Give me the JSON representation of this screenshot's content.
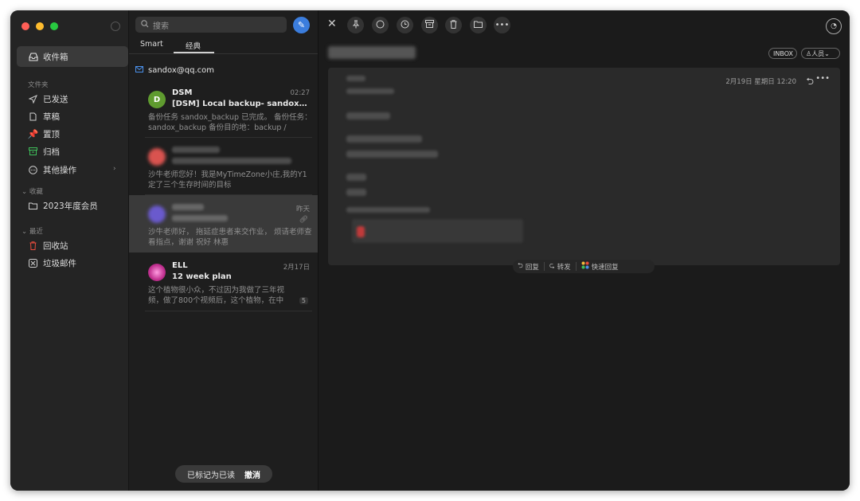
{
  "sidebar": {
    "inbox_label": "收件箱",
    "folders_section": "文件夹",
    "items": [
      {
        "label": "已发送",
        "icon": "send-icon"
      },
      {
        "label": "草稿",
        "icon": "draft-icon"
      },
      {
        "label": "置顶",
        "icon": "pin-icon"
      },
      {
        "label": "归档",
        "icon": "archive-icon"
      },
      {
        "label": "其他操作",
        "icon": "more-circle-icon"
      }
    ],
    "favorites_section": "收藏",
    "favorites": [
      {
        "label": "2023年度会员",
        "icon": "folder-icon"
      }
    ],
    "recent_section": "最近",
    "recent": [
      {
        "label": "回收站",
        "icon": "trash-icon"
      },
      {
        "label": "垃圾邮件",
        "icon": "spam-icon"
      }
    ],
    "colors": {
      "close": "#ff5f57",
      "minimize": "#febc2e",
      "zoom": "#28c840",
      "pin": "#e84c3d",
      "archive": "#3fbf5a",
      "trash": "#e84c3d"
    }
  },
  "list": {
    "search_placeholder": "搜索",
    "tabs": [
      "Smart",
      "经典"
    ],
    "account": "sandox@qq.com",
    "messages": [
      {
        "avatar": "D",
        "sender": "DSM",
        "time": "02:27",
        "subject": "[DSM] Local backup- sandox_b...",
        "preview": "备份任务 sandox_backup 已完成。 备份任务：sandox_backup 备份目的地：backup /"
      },
      {
        "preview": "沙牛老师您好！我是MyTimeZone小庄,我的Y1定了三个生存时间的目标"
      },
      {
        "time": "昨天",
        "preview": "沙牛老师好，  拖延症患者来交作业，  烦请老师查看指点，谢谢 祝好 林惠"
      },
      {
        "sender": "ELL",
        "time": "2月17日",
        "subject": "12 week plan",
        "preview": "这个植物很小众，不过因为我做了三年视频，做了800个视频后，这个植物，在中",
        "count": "5"
      }
    ],
    "toast": {
      "text": "已标记为已读",
      "undo": "撤消"
    }
  },
  "reader": {
    "chips": {
      "inbox": "INBOX",
      "people": "人员"
    },
    "date": "2月19日 星期日 12:20",
    "actions": {
      "reply": "回复",
      "forward": "转发",
      "quick_reply": "快速回复"
    }
  }
}
